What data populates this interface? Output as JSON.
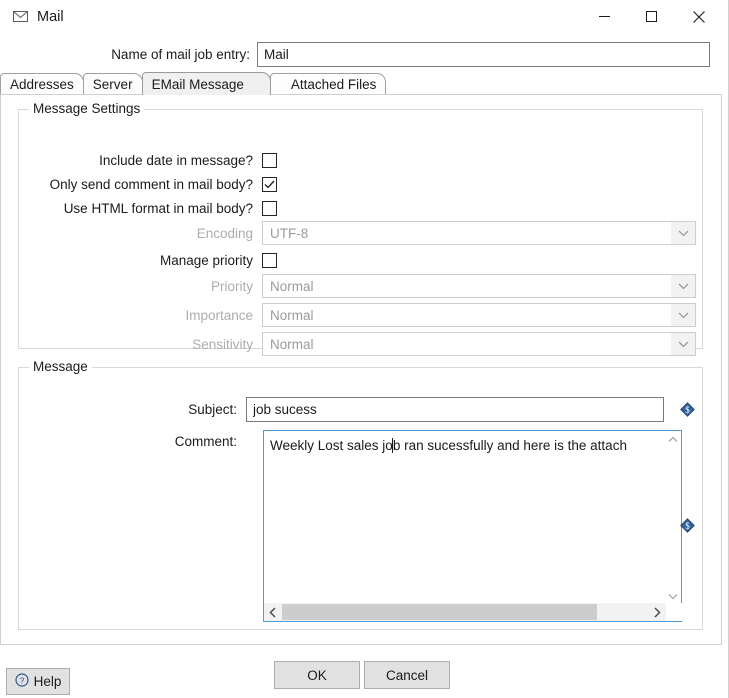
{
  "window": {
    "title": "Mail",
    "icon": "envelope-icon",
    "controls": {
      "minimize": "minimize-icon",
      "maximize": "maximize-icon",
      "close": "close-icon"
    }
  },
  "name_entry": {
    "label": "Name of mail job entry:",
    "value": "Mail"
  },
  "tabs": [
    {
      "label": "Addresses",
      "active": false
    },
    {
      "label": "Server",
      "active": false
    },
    {
      "label": "EMail Message",
      "active": true
    },
    {
      "label": "Attached Files",
      "active": false
    }
  ],
  "message_settings": {
    "title": "Message Settings",
    "include_date": {
      "label": "Include date in message?",
      "checked": false
    },
    "only_comment": {
      "label": "Only send comment in mail body?",
      "checked": true
    },
    "use_html": {
      "label": "Use HTML format in mail body?",
      "checked": false
    },
    "encoding": {
      "label": "Encoding",
      "value": "UTF-8",
      "disabled": true
    },
    "manage_priority": {
      "label": "Manage priority",
      "checked": false
    },
    "priority": {
      "label": "Priority",
      "value": "Normal",
      "disabled": true
    },
    "importance": {
      "label": "Importance",
      "value": "Normal",
      "disabled": true
    },
    "sensitivity": {
      "label": "Sensitivity",
      "value": "Normal",
      "disabled": true
    }
  },
  "message": {
    "title": "Message",
    "subject": {
      "label": "Subject:",
      "value": "job sucess"
    },
    "comment": {
      "label": "Comment:",
      "value_before_caret": "Weekly Lost sales jo",
      "value_after_caret": "b ran sucessfully and here is the attach"
    },
    "variable_icon": "variable-diamond-icon"
  },
  "footer": {
    "help": "Help",
    "help_icon": "question-circle-icon",
    "ok": "OK",
    "cancel": "Cancel"
  },
  "colors": {
    "accent_focus": "#4a9fd8",
    "diamond": "#31639c",
    "disabled_text": "#9b9b9b",
    "button_face": "#e1e1e1"
  }
}
